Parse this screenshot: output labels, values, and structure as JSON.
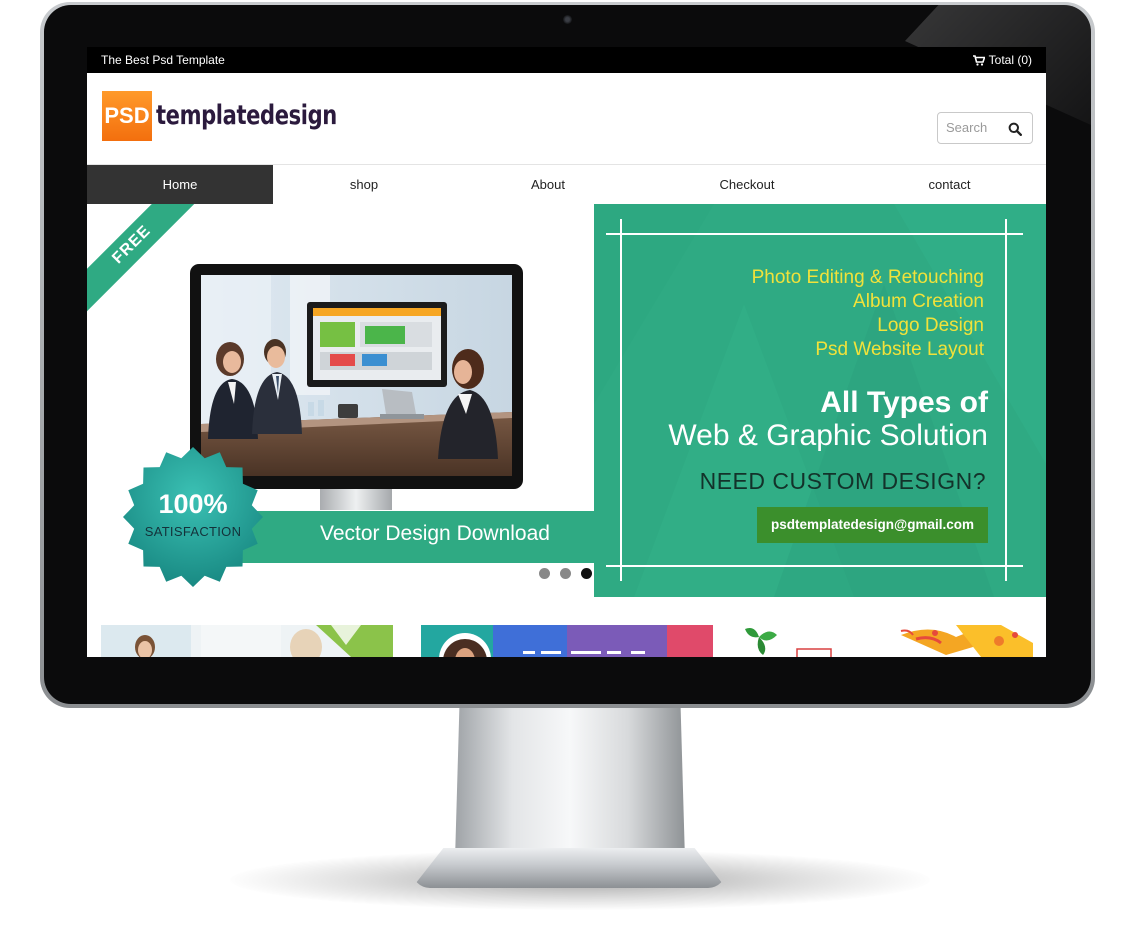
{
  "topbar": {
    "tagline": "The Best Psd Template",
    "cart_label": "Total (0)",
    "cart_icon": "shopping-cart-icon"
  },
  "header": {
    "logo_mark": "PSD",
    "logo_text": "templatedesign",
    "search": {
      "placeholder": "Search",
      "icon": "search-icon"
    }
  },
  "nav": {
    "items": [
      {
        "label": "Home",
        "active": true
      },
      {
        "label": "shop",
        "active": false
      },
      {
        "label": "About",
        "active": false
      },
      {
        "label": "Checkout",
        "active": false
      },
      {
        "label": "contact",
        "active": false
      }
    ]
  },
  "slider": {
    "ribbon": "FREE",
    "banner_label": "Vector Design Download",
    "badge": {
      "value": "100%",
      "label": "SATISFACTION"
    },
    "dots": {
      "count": 3,
      "active_index": 2
    },
    "promo": {
      "services": [
        "Photo Editing & Retouching",
        "Album Creation",
        "Logo Design",
        "Psd Website Layout"
      ],
      "title_line1": "All Types of",
      "title_line2": "Web & Graphic Solution",
      "cta": "NEED CUSTOM DESIGN?",
      "email": "psdtemplatedesign@gmail.com"
    }
  },
  "colors": {
    "accent_green": "#2faa83",
    "email_green": "#3b8f2c",
    "service_yellow": "#f1e23a",
    "nav_active": "#333333",
    "logo_orange": "#f36f0e"
  }
}
